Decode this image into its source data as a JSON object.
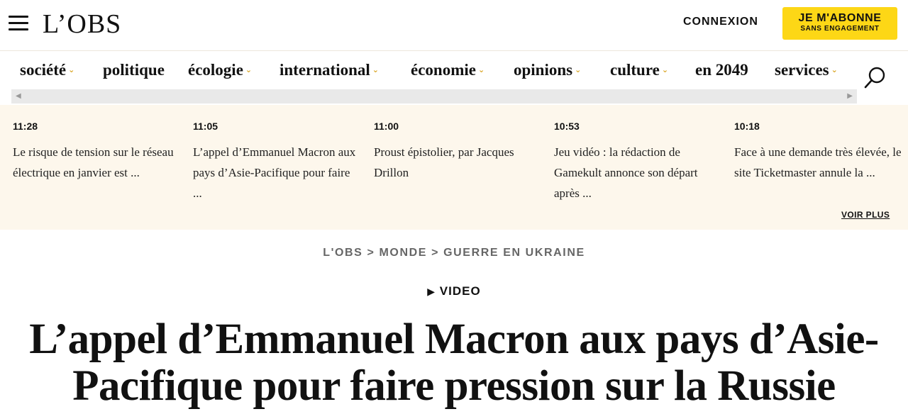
{
  "header": {
    "logo": "L’OBS",
    "login": "CONNEXION",
    "subscribe_line1": "JE M'ABONNE",
    "subscribe_line2": "SANS ENGAGEMENT",
    "subscribe_color": "#fdd716"
  },
  "nav": {
    "items": [
      {
        "label": "société",
        "has_dropdown": true
      },
      {
        "label": "politique",
        "has_dropdown": false
      },
      {
        "label": "écologie",
        "has_dropdown": true
      },
      {
        "label": "international",
        "has_dropdown": true
      },
      {
        "label": "économie",
        "has_dropdown": true
      },
      {
        "label": "opinions",
        "has_dropdown": true
      },
      {
        "label": "culture",
        "has_dropdown": true
      },
      {
        "label": "en 2049",
        "has_dropdown": false
      },
      {
        "label": "services",
        "has_dropdown": true
      }
    ],
    "search_icon": "search-icon"
  },
  "live": {
    "items": [
      {
        "time": "11:28",
        "text": "Le risque de tension sur le réseau électrique en janvier est ..."
      },
      {
        "time": "11:05",
        "text": "L’appel d’Emmanuel Macron aux pays d’Asie-Pacifique pour faire ..."
      },
      {
        "time": "11:00",
        "text": "Proust épistolier, par Jacques Drillon"
      },
      {
        "time": "10:53",
        "text": "Jeu vidéo : la rédaction de Gamekult annonce son départ après ..."
      },
      {
        "time": "10:18",
        "text": "Face à une demande très élevée, le site Ticketmaster annule la ..."
      }
    ],
    "see_more": "VOIR PLUS"
  },
  "article": {
    "breadcrumb": [
      "L'OBS",
      "MONDE",
      "GUERRE EN UKRAINE"
    ],
    "breadcrumb_separator": ">",
    "video_label": "VIDEO",
    "title": "L’appel d’Emmanuel Macron aux pays d’Asie-Pacifique pour faire pression sur la Russie"
  }
}
